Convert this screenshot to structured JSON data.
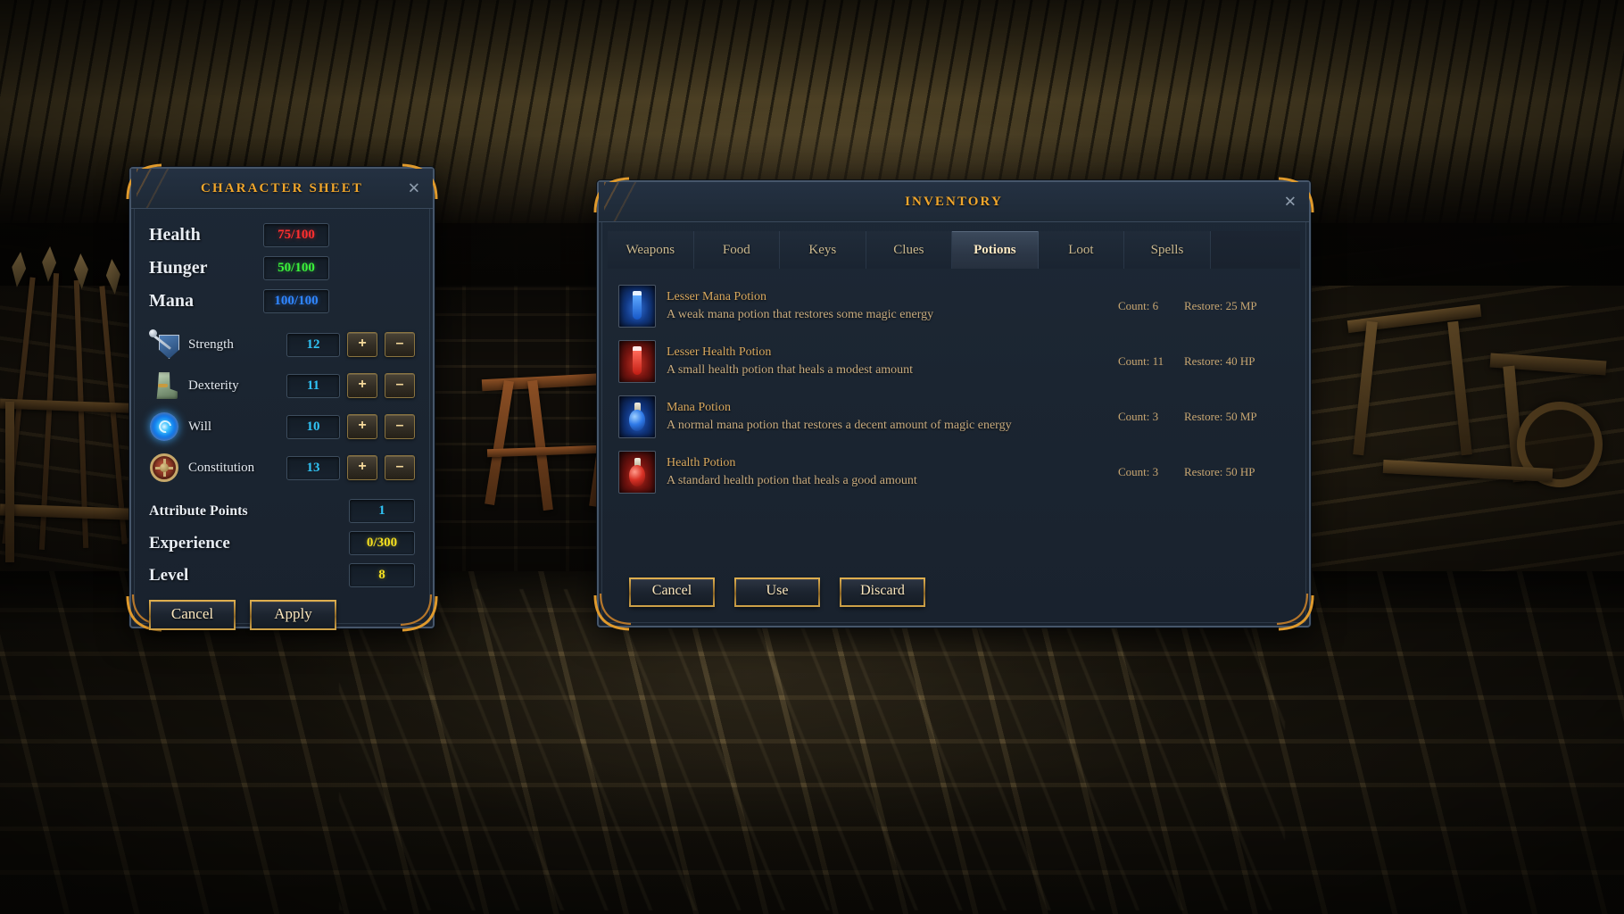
{
  "character_sheet": {
    "title": "CHARACTER SHEET",
    "close_icon": "close-icon",
    "vitals": [
      {
        "label": "Health",
        "value": "75/100",
        "color": "#ff2f2f"
      },
      {
        "label": "Hunger",
        "value": "50/100",
        "color": "#3bf23b"
      },
      {
        "label": "Mana",
        "value": "100/100",
        "color": "#2f86ff"
      }
    ],
    "attributes": [
      {
        "icon": "shield-sword-icon",
        "label": "Strength",
        "value": "12",
        "plus": "+",
        "minus": "–"
      },
      {
        "icon": "boot-icon",
        "label": "Dexterity",
        "value": "11",
        "plus": "+",
        "minus": "–"
      },
      {
        "icon": "magic-orb-icon",
        "label": "Will",
        "value": "10",
        "plus": "+",
        "minus": "–"
      },
      {
        "icon": "buckler-icon",
        "label": "Constitution",
        "value": "13",
        "plus": "+",
        "minus": "–"
      }
    ],
    "stats": [
      {
        "label": "Attribute Points",
        "value": "1",
        "color": "#30c3f5"
      },
      {
        "label": "Experience",
        "value": "0/300",
        "color": "#f5e020"
      },
      {
        "label": "Level",
        "value": "8",
        "color": "#f5e020"
      }
    ],
    "buttons": {
      "cancel": "Cancel",
      "apply": "Apply"
    }
  },
  "inventory": {
    "title": "INVENTORY",
    "close_icon": "close-icon",
    "tabs": [
      {
        "label": "Weapons",
        "active": false
      },
      {
        "label": "Food",
        "active": false
      },
      {
        "label": "Keys",
        "active": false
      },
      {
        "label": "Clues",
        "active": false
      },
      {
        "label": "Potions",
        "active": true
      },
      {
        "label": "Loot",
        "active": false
      },
      {
        "label": "Spells",
        "active": false
      }
    ],
    "items": [
      {
        "icon": "lesser-mana-potion-icon",
        "name": "Lesser Mana Potion",
        "description": "A weak mana potion that restores some magic energy",
        "count": "Count: 6",
        "restore": "Restore: 25 MP"
      },
      {
        "icon": "lesser-health-potion-icon",
        "name": "Lesser Health Potion",
        "description": "A small health potion that heals a modest amount",
        "count": "Count: 11",
        "restore": "Restore: 40 HP"
      },
      {
        "icon": "mana-potion-icon",
        "name": "Mana Potion",
        "description": "A normal mana potion that restores a decent amount of magic energy",
        "count": "Count: 3",
        "restore": "Restore: 50 MP"
      },
      {
        "icon": "health-potion-icon",
        "name": "Health Potion",
        "description": "A standard health potion that heals a good amount",
        "count": "Count: 3",
        "restore": "Restore: 50 HP"
      }
    ],
    "buttons": {
      "cancel": "Cancel",
      "use": "Use",
      "discard": "Discard"
    }
  },
  "theme": {
    "gold": "#f0a62c",
    "panel_bg": "#1b2531",
    "panel_border": "#46566a",
    "item_name": "#d8a85e",
    "item_desc": "#c8ab7e",
    "value_cyan": "#30c3f5"
  }
}
